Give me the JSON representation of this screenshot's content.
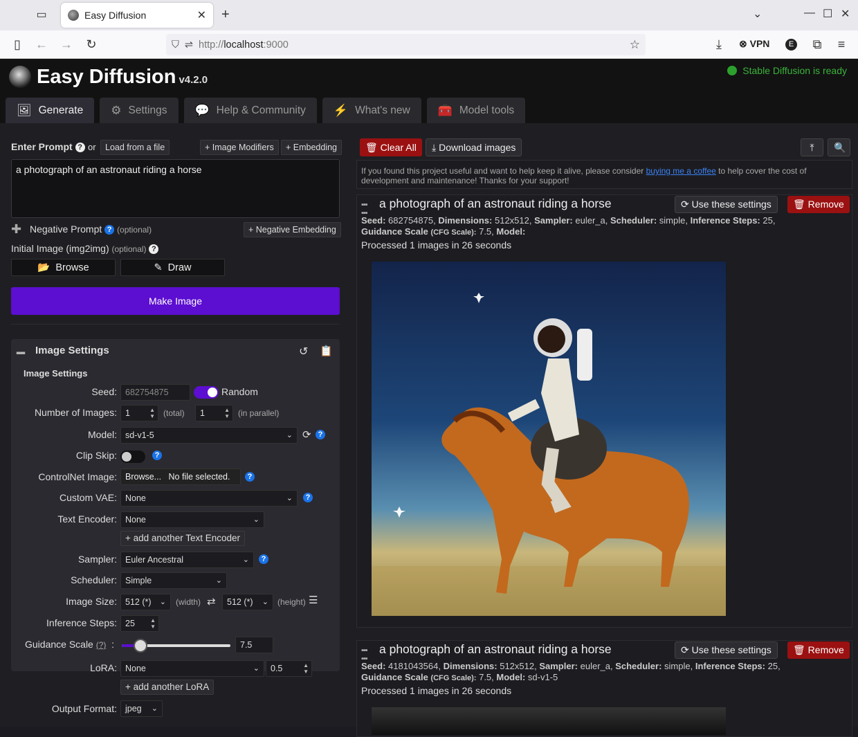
{
  "browser": {
    "tab_title": "Easy Diffusion",
    "url_prefix": "http://",
    "url_host": "localhost",
    "url_suffix": ":9000",
    "vpn_label": "VPN"
  },
  "header": {
    "title": "Easy Diffusion",
    "version": "v4.2.0",
    "status": "Stable Diffusion is ready",
    "status_color": "#2ca02c"
  },
  "tabs": [
    {
      "label": "Generate",
      "icon": "image-icon"
    },
    {
      "label": "Settings",
      "icon": "gear-icon"
    },
    {
      "label": "Help & Community",
      "icon": "comments-icon"
    },
    {
      "label": "What's new",
      "icon": "bolt-icon"
    },
    {
      "label": "Model tools",
      "icon": "toolbox-icon"
    }
  ],
  "prompt": {
    "label": "Enter Prompt",
    "or": "or",
    "load_file": "Load from a file",
    "image_modifiers": "+ Image Modifiers",
    "embedding": "+ Embedding",
    "value": "a photograph of an astronaut riding a horse",
    "negative_label": "Negative Prompt",
    "optional": "(optional)",
    "negative_embedding": "+ Negative Embedding",
    "initial_image": "Initial Image (img2img)",
    "browse": "Browse",
    "draw": "Draw",
    "make_image": "Make Image",
    "make_color": "#5c0ed1"
  },
  "image_settings": {
    "panel_title": "Image Settings",
    "sub_title": "Image Settings",
    "seed_label": "Seed:",
    "seed_value": "682754875",
    "random_label": "Random",
    "num_images_label": "Number of Images:",
    "num_total": "1",
    "total": "(total)",
    "num_parallel": "1",
    "parallel": "(in parallel)",
    "model_label": "Model:",
    "model_value": "sd-v1-5",
    "clip_skip_label": "Clip Skip:",
    "controlnet_label": "ControlNet Image:",
    "controlnet_browse": "Browse...",
    "controlnet_file": "No file selected.",
    "vae_label": "Custom VAE:",
    "vae_value": "None",
    "text_encoder_label": "Text Encoder:",
    "text_encoder_value": "None",
    "add_text_encoder": "+ add another Text Encoder",
    "sampler_label": "Sampler:",
    "sampler_value": "Euler Ancestral",
    "scheduler_label": "Scheduler:",
    "scheduler_value": "Simple",
    "image_size_label": "Image Size:",
    "width_value": "512 (*)",
    "width": "(width)",
    "height_value": "512 (*)",
    "height": "(height)",
    "steps_label": "Inference Steps:",
    "steps_value": "25",
    "guidance_label": "Guidance Scale",
    "guidance_help": "(?)",
    "guidance_value": "7.5",
    "guidance_fraction": 0.17,
    "lora_label": "LoRA:",
    "lora_value": "None",
    "lora_strength": "0.5",
    "add_lora": "+ add another LoRA",
    "output_format_label": "Output Format:",
    "output_format_value": "jpeg"
  },
  "results": {
    "clear_all": "Clear All",
    "download": "Download images",
    "donate_text_1": "If you found this project useful and want to help keep it alive, please consider",
    "donate_link": "buying me a coffee",
    "donate_text_2": "to help cover the cost of development and maintenance! Thanks for your support!",
    "cards": [
      {
        "title": "a photograph of an astronaut riding a horse",
        "use_settings": "Use these settings",
        "remove": "Remove",
        "seed": "682754875",
        "dimensions": "512x512",
        "sampler": "euler_a",
        "scheduler": "simple",
        "steps": "25",
        "guidance": "7.5",
        "model": "",
        "processed": "Processed 1 images in 26 seconds"
      },
      {
        "title": "a photograph of an astronaut riding a horse",
        "use_settings": "Use these settings",
        "remove": "Remove",
        "seed": "4181043564",
        "dimensions": "512x512",
        "sampler": "euler_a",
        "scheduler": "simple",
        "steps": "25",
        "guidance": "7.5",
        "model": "sd-v1-5",
        "processed": "Processed 1 images in 26 seconds"
      }
    ],
    "meta_labels": {
      "seed": "Seed:",
      "dimensions": "Dimensions:",
      "sampler": "Sampler:",
      "scheduler": "Scheduler:",
      "steps": "Inference Steps:",
      "guidance": "Guidance Scale",
      "cfg": "(CFG Scale):",
      "model": "Model:"
    }
  }
}
